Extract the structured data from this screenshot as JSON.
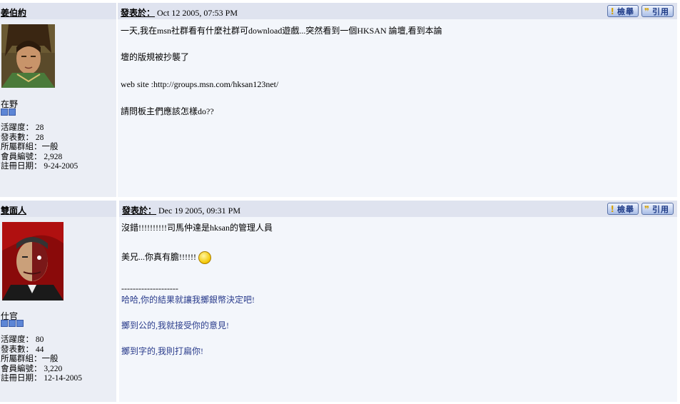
{
  "posts": [
    {
      "username": "姜伯約",
      "rank": "在野",
      "rank_stars": 2,
      "stats": [
        "活躍度： 28",
        "發表數： 28",
        "所屬群組：一般",
        "會員編號： 2,928",
        "註冊日期： 9-24-2005"
      ],
      "posted_label": "發表於：",
      "posted_date": "Oct 12 2005, 07:53 PM",
      "lines": [
        "一天,我在msn社群看有什麼社群可download遊戲...突然看到一個HKSAN 論壇,看到本論",
        "壇的版規被抄襲了",
        "web site :http://groups.msn.com/hksan123net/",
        "請問板主們應該怎樣do??"
      ]
    },
    {
      "username": "雙面人",
      "rank": "仕官",
      "rank_stars": 3,
      "stats": [
        "活躍度： 80",
        "發表數： 44",
        "所屬群組：一般",
        "會員編號： 3,220",
        "註冊日期： 12-14-2005"
      ],
      "posted_label": "發表於：",
      "posted_date": "Dec 19 2005, 09:31 PM",
      "lines": [
        "沒錯!!!!!!!!!!司馬仲達是hksan的管理人員",
        "美兄...你真有膽!!!!!!",
        "--------------------",
        "哈哈,你的結果就讓我擲銀幣決定吧!",
        "擲到公的,我就接受你的意見!",
        "擲到字的,我則打扁你!"
      ]
    }
  ],
  "buttons": {
    "search": "檢舉",
    "quote": "引用"
  },
  "icons": {
    "search": "exclamation-icon",
    "quote": "speech-bubble-icon",
    "emoticon": "smiley-icon"
  }
}
